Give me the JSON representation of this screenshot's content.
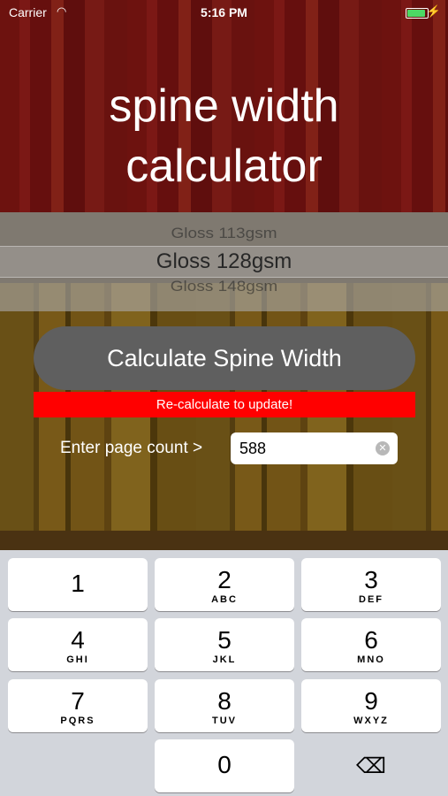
{
  "status_bar": {
    "carrier": "Carrier",
    "wifi_icon": "wifi-icon",
    "time": "5:16 PM",
    "battery_color": "#4cd964"
  },
  "title": {
    "line1": "spine width",
    "line2": "calculator"
  },
  "paper_picker": {
    "options": [
      "Gloss 113gsm",
      "Gloss 128gsm",
      "Gloss 148gsm"
    ],
    "selected": "Gloss 128gsm"
  },
  "calculate_button": {
    "label": "Calculate Spine Width"
  },
  "warning": {
    "text": "Re-calculate to update!",
    "color": "#ff0000"
  },
  "page_count": {
    "label": "Enter page count >",
    "value": "588",
    "clear_icon": "clear-circle-icon"
  },
  "keypad": {
    "keys": [
      {
        "num": "1",
        "letters": ""
      },
      {
        "num": "2",
        "letters": "ABC"
      },
      {
        "num": "3",
        "letters": "DEF"
      },
      {
        "num": "4",
        "letters": "GHI"
      },
      {
        "num": "5",
        "letters": "JKL"
      },
      {
        "num": "6",
        "letters": "MNO"
      },
      {
        "num": "7",
        "letters": "PQRS"
      },
      {
        "num": "8",
        "letters": "TUV"
      },
      {
        "num": "9",
        "letters": "WXYZ"
      },
      {
        "num": "0",
        "letters": ""
      }
    ],
    "delete_icon": "backspace-icon",
    "delete_glyph": "⌫"
  }
}
